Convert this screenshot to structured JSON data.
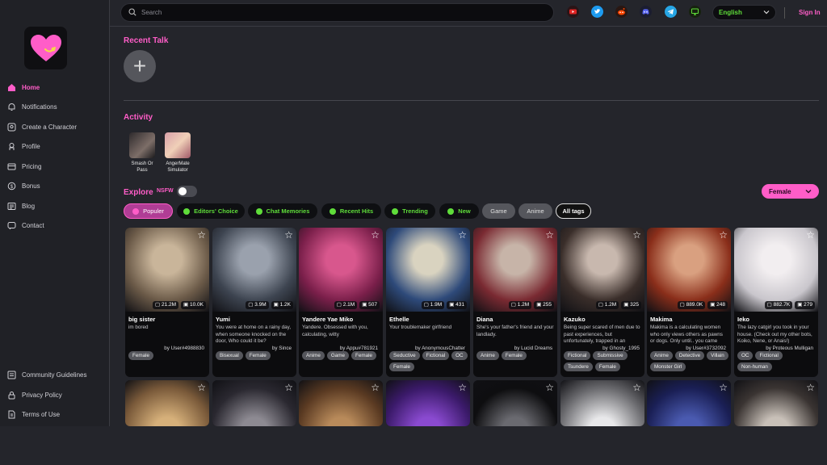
{
  "colors": {
    "accent": "#ff5dc8",
    "green": "#5fdd3a",
    "bg": "#24252b"
  },
  "search": {
    "placeholder": "Search"
  },
  "social": [
    {
      "icon": "youtube-icon",
      "color": "#e02424"
    },
    {
      "icon": "twitter-icon",
      "color": "#1d9bf0"
    },
    {
      "icon": "reddit-icon",
      "color": "#ff4500"
    },
    {
      "icon": "discord-icon",
      "color": "#5865f2"
    },
    {
      "icon": "telegram-icon",
      "color": "#27a6e5"
    },
    {
      "icon": "monitor-icon",
      "color": "#5fdd3a"
    }
  ],
  "language": {
    "selected": "English"
  },
  "header": {
    "sign_in": "Sign In"
  },
  "sidebar": {
    "items": [
      {
        "label": "Home",
        "icon": "home-icon",
        "active": true
      },
      {
        "label": "Notifications",
        "icon": "bell-icon"
      },
      {
        "label": "Create a Character",
        "icon": "create-character-icon"
      },
      {
        "label": "Profile",
        "icon": "profile-icon"
      },
      {
        "label": "Pricing",
        "icon": "pricing-icon"
      },
      {
        "label": "Bonus",
        "icon": "bonus-icon"
      },
      {
        "label": "Blog",
        "icon": "blog-icon"
      },
      {
        "label": "Contact",
        "icon": "contact-icon"
      }
    ],
    "footer": [
      {
        "label": "Community Guidelines",
        "icon": "guidelines-icon"
      },
      {
        "label": "Privacy Policy",
        "icon": "lock-icon"
      },
      {
        "label": "Terms of Use",
        "icon": "document-icon"
      }
    ]
  },
  "recent_talk": {
    "title": "Recent Talk",
    "add": "+"
  },
  "activity": {
    "title": "Activity",
    "items": [
      {
        "label_line1": "Smash Or",
        "label_line2": "Pass"
      },
      {
        "label_line1": "AngerMate",
        "label_line2": "Simulator"
      }
    ]
  },
  "explore": {
    "title": "Explore",
    "nsfw_label": "NSFW",
    "nsfw_enabled": false,
    "gender": "Female",
    "chips": [
      {
        "label": "Populer",
        "style": "active"
      },
      {
        "label": "Editors' Choice",
        "style": "green"
      },
      {
        "label": "Chat Memories",
        "style": "green"
      },
      {
        "label": "Recent Hits",
        "style": "green"
      },
      {
        "label": "Trending",
        "style": "green"
      },
      {
        "label": "New",
        "style": "green"
      },
      {
        "label": "Game",
        "style": "grey"
      },
      {
        "label": "Anime",
        "style": "grey"
      },
      {
        "label": "All tags",
        "style": "outline"
      }
    ]
  },
  "cards": [
    {
      "name": "big sister",
      "desc": "im bored",
      "author": "by User#4988830",
      "chats": "21.2M",
      "likes": "10.0K",
      "tags": [
        "Female"
      ],
      "art": [
        "#6b5a48",
        "#c9b59a"
      ]
    },
    {
      "name": "Yumi",
      "desc": "You were at home on a rainy day, when someone knocked on the door, Who could it be?",
      "author": "by Since",
      "chats": "3.9M",
      "likes": "1.2K",
      "tags": [
        "Bisexual",
        "Female"
      ],
      "art": [
        "#3d4450",
        "#9aa1ad"
      ]
    },
    {
      "name": "Yandere Yae Miko",
      "desc": "Yandere. Obsessed with you, calculating, witty",
      "author": "by Appu#781921",
      "chats": "2.1M",
      "likes": "507",
      "tags": [
        "Anime",
        "Game",
        "Female"
      ],
      "art": [
        "#7a1f4a",
        "#d8578d"
      ]
    },
    {
      "name": "Ethelle",
      "desc": "Your troublemaker girlfriend",
      "author": "by AnonymousChatter",
      "chats": "1.9M",
      "likes": "431",
      "tags": [
        "Seductive",
        "Fictional",
        "OC",
        "Female"
      ],
      "art": [
        "#2e4a7a",
        "#d9d3c0"
      ]
    },
    {
      "name": "Diana",
      "desc": "She's your father's friend and your landlady.",
      "author": "by Lucid Dreams",
      "chats": "1.2M",
      "likes": "255",
      "tags": [
        "Anime",
        "Female"
      ],
      "art": [
        "#7a2a32",
        "#c7b4a8"
      ]
    },
    {
      "name": "Kazuko",
      "desc": "Being super scared of men due to past experiences, but unfortunately, trapped in an",
      "author": "by Ghosty_1995",
      "chats": "1.2M",
      "likes": "325",
      "tags": [
        "Fictional",
        "Submissive",
        "Tsundere",
        "Female"
      ],
      "art": [
        "#3a2e2a",
        "#c8b8ae"
      ]
    },
    {
      "name": "Makima",
      "desc": "Makima is a calculating women who only views others as pawns or dogs. Only until.. you came",
      "author": "by User#3732092",
      "chats": "889.0K",
      "likes": "248",
      "tags": [
        "Anime",
        "Detective",
        "Villain",
        "Monster Girl"
      ],
      "art": [
        "#8a2e1a",
        "#d9a080"
      ]
    },
    {
      "name": "Ieko",
      "desc": "The lazy catgirl you took in your house. (Check out my other bots, Koiko, Nene, or Anais!)",
      "author": "by Proteous Mulligan",
      "chats": "882.7K",
      "likes": "279",
      "tags": [
        "OC",
        "Fictional",
        "Non-human"
      ],
      "art": [
        "#c9c6cc",
        "#f2eef0"
      ]
    }
  ],
  "cards_row2": [
    {
      "art": [
        "#7a5a3a",
        "#d6b07a"
      ]
    },
    {
      "art": [
        "#2a2830",
        "#8d8a92"
      ]
    },
    {
      "art": [
        "#5a3a22",
        "#b88a5a"
      ]
    },
    {
      "art": [
        "#3b1a6a",
        "#8a4ad0"
      ]
    },
    {
      "art": [
        "#0e0e10",
        "#6a6a70"
      ]
    },
    {
      "art": [
        "#6a6a6e",
        "#e8e8ea"
      ]
    },
    {
      "art": [
        "#1a1f55",
        "#4a5ab0"
      ]
    },
    {
      "art": [
        "#3a3432",
        "#c8c0b8"
      ]
    }
  ]
}
